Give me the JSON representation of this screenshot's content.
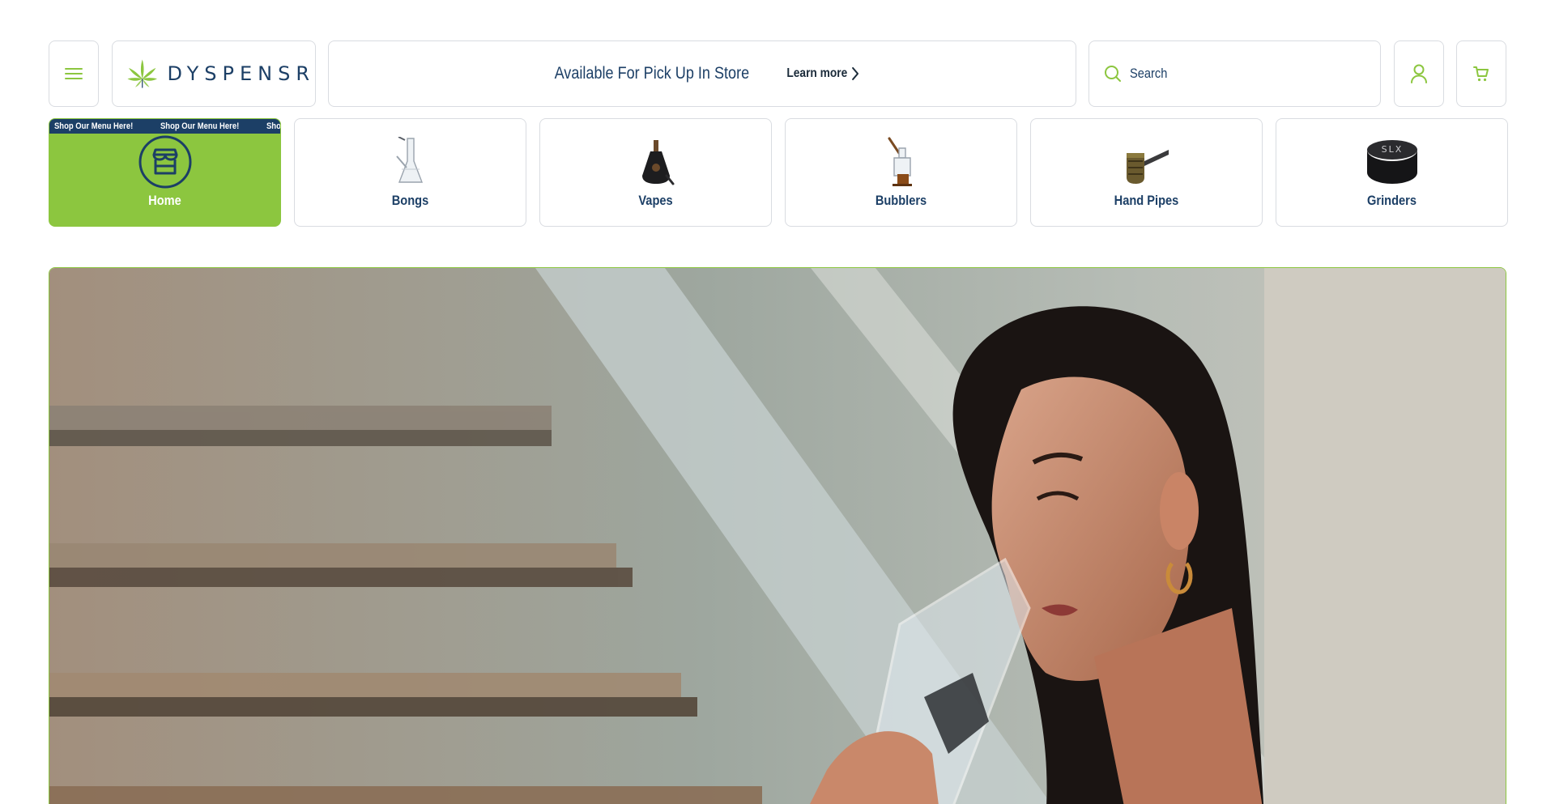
{
  "header": {
    "menu_icon": "hamburger-icon",
    "logo_text": "DYSPENSR",
    "announcement": "Available For Pick Up In Store",
    "learn_more": "Learn more",
    "search_placeholder": "Search",
    "account_icon": "user-icon",
    "cart_icon": "cart-icon"
  },
  "ticker": {
    "items": [
      "Shop Our Menu Here!",
      "Shop Our Menu Here!",
      "Shop Our Menu Here!"
    ]
  },
  "categories": [
    {
      "label": "Home",
      "icon": "store-icon"
    },
    {
      "label": "Bongs",
      "icon": "bong-icon"
    },
    {
      "label": "Vapes",
      "icon": "vape-icon"
    },
    {
      "label": "Bubblers",
      "icon": "bubbler-icon"
    },
    {
      "label": "Hand Pipes",
      "icon": "hand-pipe-icon"
    },
    {
      "label": "Grinders",
      "icon": "grinder-icon"
    }
  ],
  "grinder_brand": "SLX",
  "colors": {
    "brand_green": "#8cc63f",
    "brand_navy": "#1c3f66",
    "border": "#d9dce1"
  }
}
